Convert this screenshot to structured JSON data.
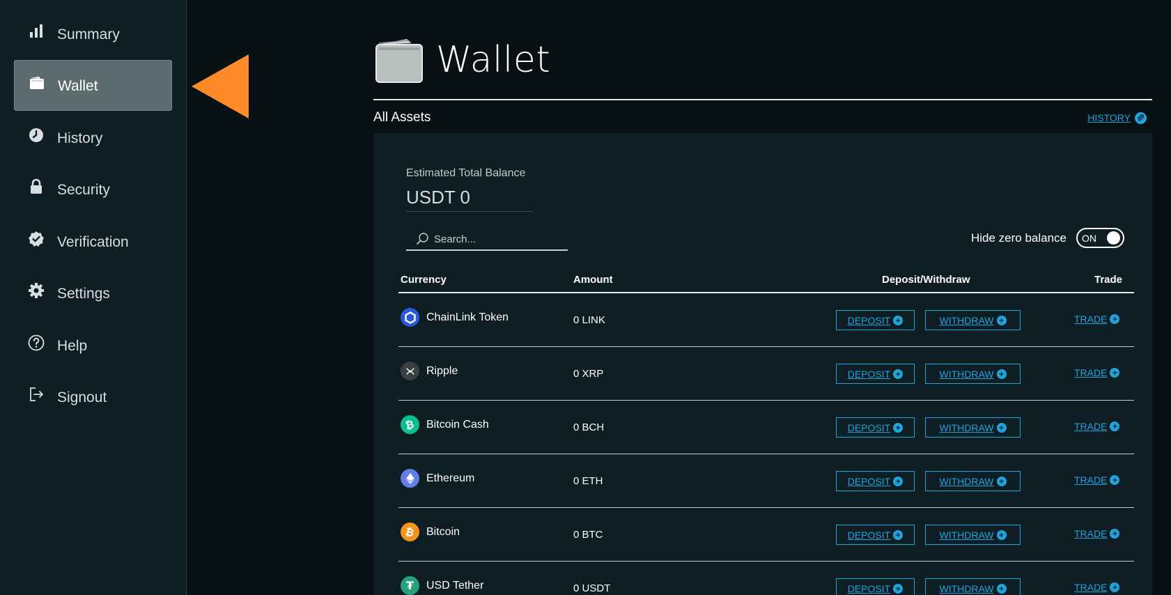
{
  "sidebar": {
    "items": [
      {
        "label": "Summary",
        "icon": "bar-chart-icon"
      },
      {
        "label": "Wallet",
        "icon": "wallet-icon",
        "active": true
      },
      {
        "label": "History",
        "icon": "clock-icon"
      },
      {
        "label": "Security",
        "icon": "lock-icon"
      },
      {
        "label": "Verification",
        "icon": "check-badge-icon"
      },
      {
        "label": "Settings",
        "icon": "gear-icon"
      },
      {
        "label": "Help",
        "icon": "question-circle-icon"
      },
      {
        "label": "Signout",
        "icon": "signout-icon"
      }
    ]
  },
  "header": {
    "title": "Wallet",
    "section_title": "All Assets",
    "history_link": "HISTORY"
  },
  "balance": {
    "label": "Estimated Total Balance",
    "value": "USDT 0"
  },
  "search": {
    "placeholder": "Search..."
  },
  "hide_zero": {
    "label": "Hide zero balance",
    "state": "ON"
  },
  "table": {
    "headers": {
      "currency": "Currency",
      "amount": "Amount",
      "deposit_withdraw": "Deposit/Withdraw",
      "trade": "Trade"
    },
    "actions": {
      "deposit": "DEPOSIT",
      "withdraw": "WITHDRAW",
      "trade": "TRADE"
    },
    "rows": [
      {
        "name": "ChainLink Token",
        "amount": "0 LINK",
        "icon_color": "#2a5ada",
        "icon": "chainlink-icon"
      },
      {
        "name": "Ripple",
        "amount": "0 XRP",
        "icon_color": "#3a3f42",
        "icon": "ripple-icon"
      },
      {
        "name": "Bitcoin Cash",
        "amount": "0 BCH",
        "icon_color": "#0ac18e",
        "icon": "bitcoin-cash-icon"
      },
      {
        "name": "Ethereum",
        "amount": "0 ETH",
        "icon_color": "#627eea",
        "icon": "ethereum-icon"
      },
      {
        "name": "Bitcoin",
        "amount": "0 BTC",
        "icon_color": "#f7931a",
        "icon": "bitcoin-icon"
      },
      {
        "name": "USD Tether",
        "amount": "0 USDT",
        "icon_color": "#26a17b",
        "icon": "tether-icon"
      }
    ]
  },
  "colors": {
    "accent": "#1fa4dc",
    "pointer": "#ff8a2a",
    "sidebar_bg": "#0f1e24",
    "active_bg": "#5d6b6e"
  }
}
